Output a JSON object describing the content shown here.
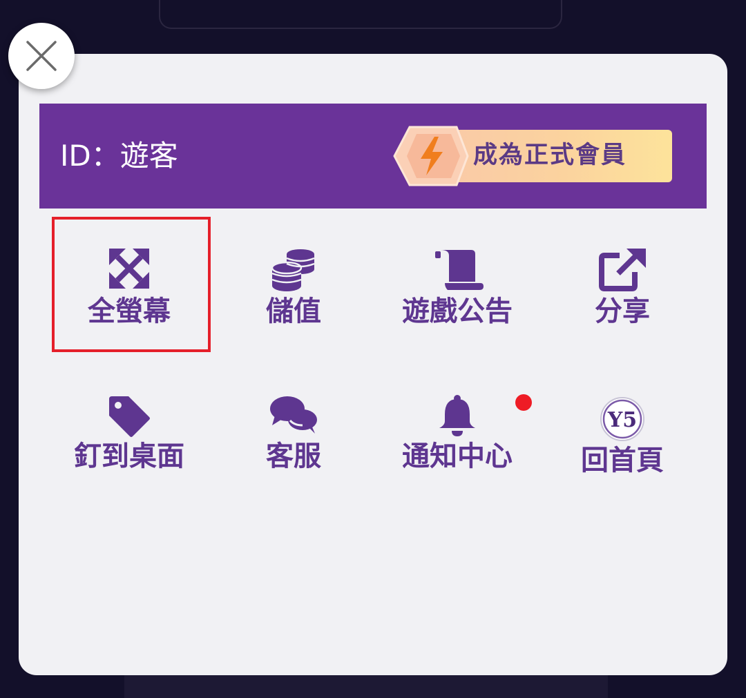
{
  "header": {
    "user_id_text": "ID：遊客",
    "member_button_label": "成為正式會員"
  },
  "menu": {
    "items": [
      {
        "label": "全螢幕",
        "icon": "fullscreen-expand-icon"
      },
      {
        "label": "儲值",
        "icon": "coins-icon"
      },
      {
        "label": "遊戲公告",
        "icon": "scroll-icon"
      },
      {
        "label": "分享",
        "icon": "share-external-icon"
      },
      {
        "label": "釘到桌面",
        "icon": "tag-icon"
      },
      {
        "label": "客服",
        "icon": "chat-bubbles-icon"
      },
      {
        "label": "通知中心",
        "icon": "bell-icon"
      },
      {
        "label": "回首頁",
        "icon": "y5-logo-icon"
      }
    ],
    "y5_logo_text": "Y5"
  },
  "colors": {
    "panel_bg": "#f1f1f4",
    "header_bg": "#6a3399",
    "accent_purple": "#5e3690",
    "highlight_red": "#e51f2a",
    "notification_dot": "#ee1c25",
    "lightning_orange": "#f07e1e"
  }
}
